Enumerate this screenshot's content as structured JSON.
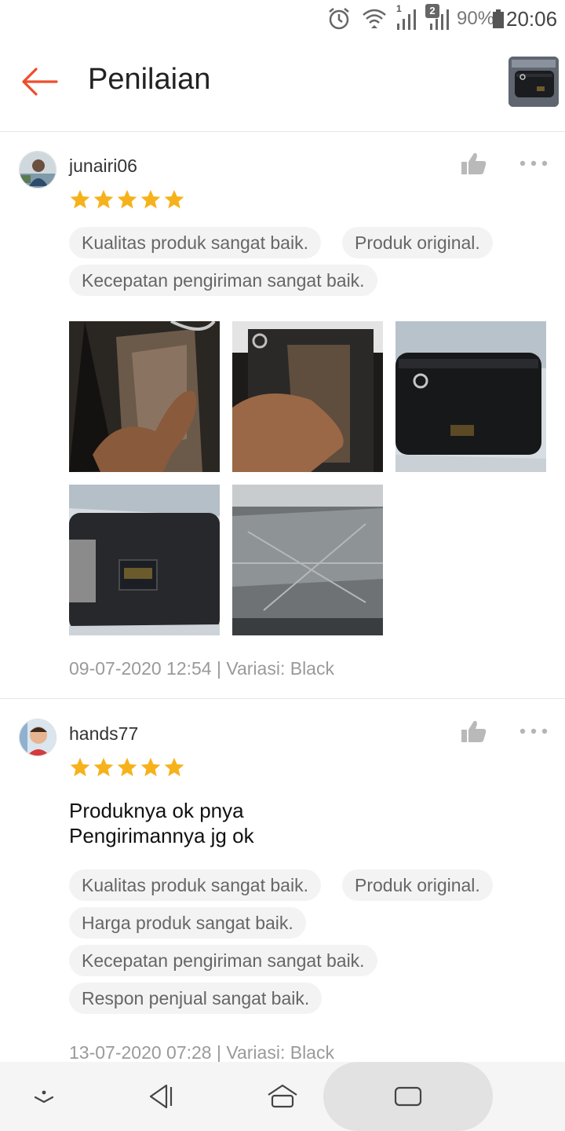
{
  "status_bar": {
    "battery": "90%",
    "time": "20:06",
    "sim1_label": "1",
    "sim2_label": "2"
  },
  "header": {
    "title": "Penilaian"
  },
  "reviews": [
    {
      "username": "junairi06",
      "rating": 5,
      "comment": "",
      "tags": [
        "Kualitas produk sangat baik.",
        "Produk original.",
        "Kecepatan pengiriman sangat baik."
      ],
      "meta": "09-07-2020 12:54 | Variasi: Black"
    },
    {
      "username": "hands77",
      "rating": 5,
      "comment_line1": "Produknya ok pnya",
      "comment_line2": "Pengirimannya jg ok",
      "tags": [
        "Kualitas produk sangat baik.",
        "Produk original.",
        "Harga produk sangat baik.",
        "Kecepatan pengiriman sangat baik.",
        "Respon penjual sangat baik."
      ],
      "meta": "13-07-2020 07:28 | Variasi: Black"
    }
  ],
  "colors": {
    "accent": "#ee4d2d",
    "star": "#f6b21b",
    "tag_bg": "#f3f3f3"
  },
  "icons": {
    "back": "arrow-left-icon",
    "like": "thumb-up-icon",
    "more": "more-dots-icon"
  }
}
